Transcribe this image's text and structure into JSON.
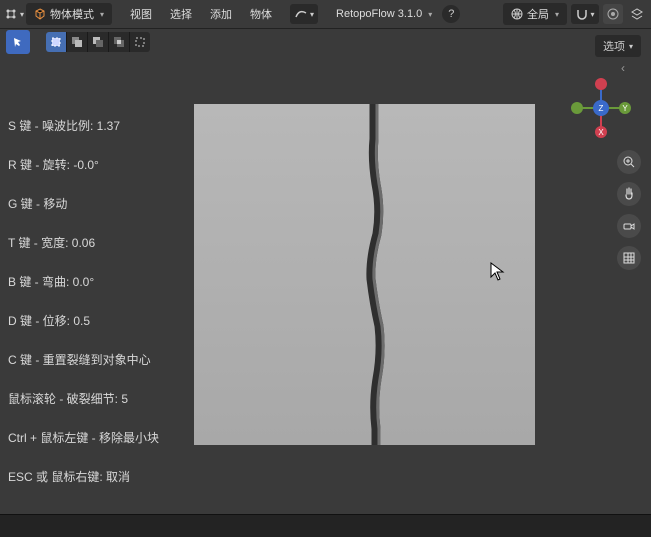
{
  "header": {
    "mode_label": "物体模式",
    "menu_view": "视图",
    "menu_select": "选择",
    "menu_add": "添加",
    "menu_object": "物体",
    "addon_label": "RetopoFlow 3.1.0",
    "orient_label": "全局",
    "options_label": "选项"
  },
  "hints": {
    "s": "S 键 - 噪波比例:  1.37",
    "r": "R 键 - 旋转:  -0.0°",
    "g": "G 键 - 移动",
    "t": "T 键 - 宽度:  0.06",
    "b": "B 键 - 弯曲:  0.0°",
    "d": "D 键 - 位移:  0.5",
    "c": "C 键 - 重置裂缝到对象中心",
    "wheel": "鼠标滚轮 - 破裂细节:  5",
    "ctrl": "Ctrl + 鼠标左键 - 移除最小块",
    "esc": "ESC 或 鼠标右键: 取消"
  },
  "values": {
    "noise_ratio": 1.37,
    "rotation_deg": 0.0,
    "width": 0.06,
    "bend_deg": 0.0,
    "offset": 0.5,
    "detail": 5
  },
  "gizmo": {
    "x": "X",
    "y": "Y",
    "z": "Z"
  },
  "chart_data": null
}
